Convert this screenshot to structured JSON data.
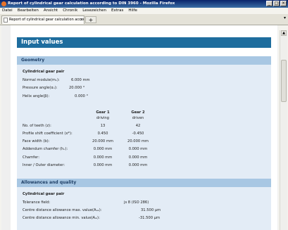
{
  "window": {
    "title": "Report of cylindrical gear calculation according to DIN 3960 - Mozilla Firefox"
  },
  "menu": [
    "Datei",
    "Bearbeiten",
    "Ansicht",
    "Chronik",
    "Lesezeichen",
    "Extras",
    "Hilfe"
  ],
  "tab": {
    "label": "Report of cylindrical gear calculation accordi...",
    "close": "x",
    "new": "+"
  },
  "page": {
    "title": "Input values"
  },
  "geometry": {
    "header": "Geometry",
    "subheader": "Cylindrical gear pair",
    "rows": [
      {
        "label": "Normal module(mₙ):",
        "value": "6.000 mm"
      },
      {
        "label": "Pressure angle(αₙ):",
        "value": "20.000 °"
      },
      {
        "label": "Helix angle(β):",
        "value": "0.000 °"
      }
    ],
    "gear1": "Gear 1",
    "gear2": "Gear 2",
    "gear1_role": "driving",
    "gear2_role": "driven",
    "table": [
      {
        "label": "No. of teeth (z):",
        "g1": "13",
        "g2": "42"
      },
      {
        "label": "Profile shift coefficient (x*):",
        "g1": "0.450",
        "g2": "-0.450"
      },
      {
        "label": "Face width (b):",
        "g1": "20.000 mm",
        "g2": "20.000 mm"
      },
      {
        "label": "Addendum chamfer (hᵤ):",
        "g1": "0.000 mm",
        "g2": "0.000 mm"
      },
      {
        "label": "Chamfer:",
        "g1": "0.000 mm",
        "g2": "0.000 mm"
      },
      {
        "label": "Inner / Outer diameter:",
        "g1": "0.000 mm",
        "g2": "0.000 mm"
      }
    ]
  },
  "allowances": {
    "header": "Allowances and quality",
    "subheader": "Cylindrical gear pair",
    "rows": [
      {
        "label": "Tolerance field:",
        "value": "js 8 (ISO 286)"
      },
      {
        "label": "Centre distance allowance max. value(Aₐₑ):",
        "value": "31.500 µm"
      },
      {
        "label": "Centre distance allowance min. value(Aₐᵢ):",
        "value": "-31.500 µm"
      }
    ]
  }
}
